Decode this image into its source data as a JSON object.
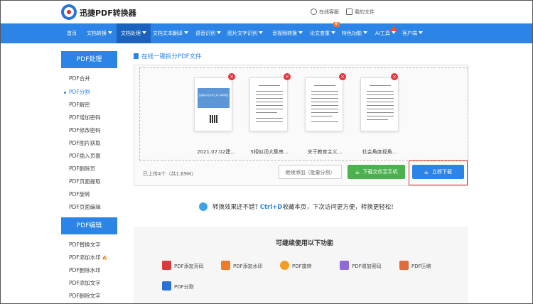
{
  "header": {
    "brand": "迅捷PDF转换器",
    "service": "在线客服",
    "my_files": "我的文件"
  },
  "nav": {
    "items": [
      {
        "label": "首页"
      },
      {
        "label": "文档转换"
      },
      {
        "label": "文档处理"
      },
      {
        "label": "文档文本翻译"
      },
      {
        "label": "语音识别"
      },
      {
        "label": "图片文字识别"
      },
      {
        "label": "音视频转换"
      },
      {
        "label": "论文查重"
      },
      {
        "label": "特色功能"
      },
      {
        "label": "AI工具"
      },
      {
        "label": "客户端"
      }
    ],
    "new_badge": "新"
  },
  "sidebar": {
    "group1_title": "PDF处理",
    "group1_items": [
      {
        "label": "PDF合并"
      },
      {
        "label": "PDF分割"
      },
      {
        "label": "PDF解密"
      },
      {
        "label": "PDF增加密码"
      },
      {
        "label": "PDF修改密码"
      },
      {
        "label": "PDF图片获取"
      },
      {
        "label": "PDF插入页面"
      },
      {
        "label": "PDF删除页"
      },
      {
        "label": "PDF页面提取"
      },
      {
        "label": "PDF旋转"
      },
      {
        "label": "PDF页面编辑"
      }
    ],
    "group2_title": "PDF编辑",
    "group2_items": [
      {
        "label": "PDF替换文字"
      },
      {
        "label": "PDF添加水印"
      },
      {
        "label": "PDF删除水印"
      },
      {
        "label": "PDF添加文字"
      },
      {
        "label": "PDF删除文字"
      }
    ]
  },
  "main": {
    "title": "在线一键拆分PDF文件",
    "cover_title": "迅捷电子书分享工具—海华收集",
    "files": [
      {
        "name": "2021.07.02建..."
      },
      {
        "name": "5相似词大集串..."
      },
      {
        "name": "关于教育主义..."
      },
      {
        "name": "社会角度视角..."
      }
    ],
    "summary": "已上传4个（共1.69M）",
    "add_button": "继续添加（批量分割）",
    "phone_button": "下载文件至手机",
    "download_button": "立即下载",
    "tip_prefix": "转换效果还不错?",
    "tip_key": "Ctrl+D",
    "tip_suffix": "收藏本页，下次访问更方便，转换更轻松!",
    "more_title": "可继续使用以下功能",
    "functions": [
      {
        "label": "PDF添加页码",
        "color": "#d83b3b"
      },
      {
        "label": "PDF添加水印",
        "color": "#f07a2b"
      },
      {
        "label": "PDF旋转",
        "color": "#f39c1f"
      },
      {
        "label": "PDF增加密码",
        "color": "#8e6bd6"
      },
      {
        "label": "PDF压缩",
        "color": "#e06b3b"
      },
      {
        "label": "PDF分割",
        "color": "#2b6fd6"
      }
    ]
  }
}
